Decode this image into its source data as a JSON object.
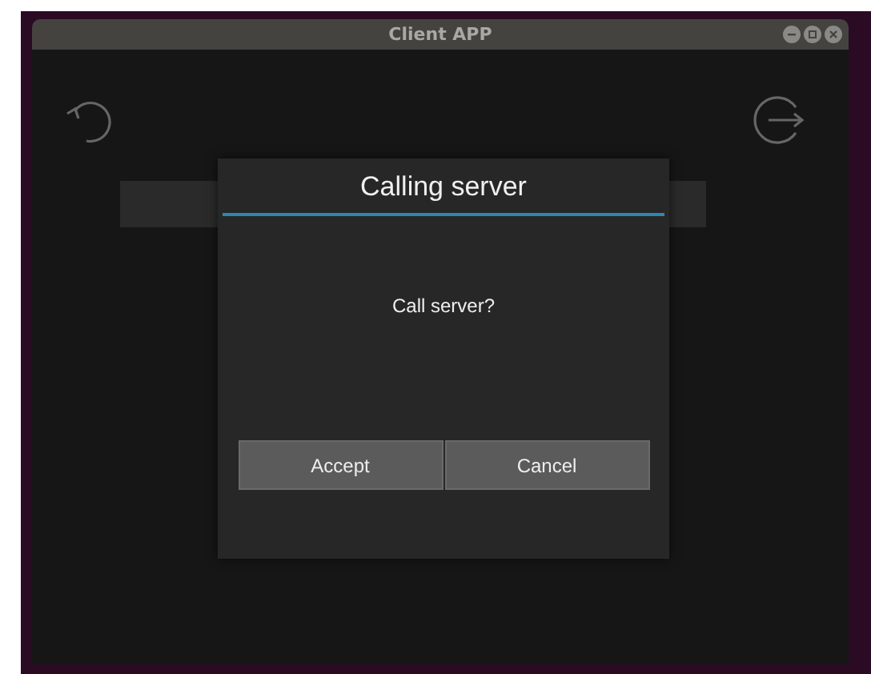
{
  "window": {
    "title": "Client APP"
  },
  "dialog": {
    "title": "Calling server",
    "message": "Call server?",
    "buttons": [
      "Accept",
      "Cancel"
    ]
  }
}
